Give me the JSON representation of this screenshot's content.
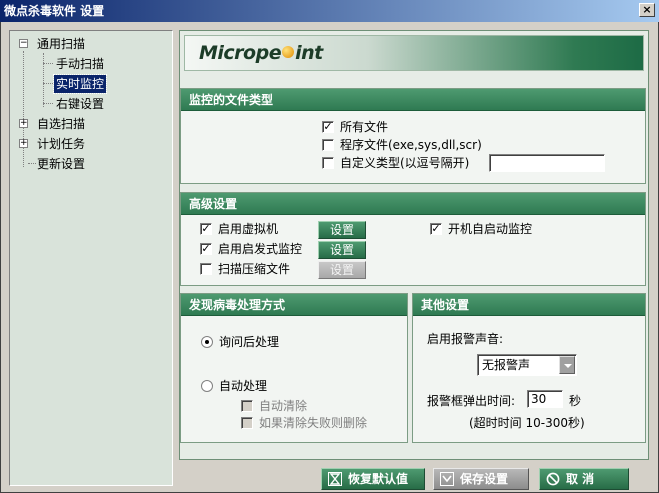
{
  "window": {
    "title": "微点杀毒软件 设置",
    "close_label": "×"
  },
  "tree": {
    "items": [
      {
        "label": "通用扫描",
        "expander": "−"
      },
      {
        "label": "手动扫描"
      },
      {
        "label": "实时监控"
      },
      {
        "label": "右键设置"
      },
      {
        "label": "自选扫描",
        "expander": "+"
      },
      {
        "label": "计划任务",
        "expander": "+"
      },
      {
        "label": "更新设置"
      }
    ]
  },
  "banner": {
    "logo_pre": "Micrope",
    "logo_post": "int"
  },
  "file_types": {
    "header": "监控的文件类型",
    "all_files": "所有文件",
    "program_files": "程序文件(exe,sys,dll,scr)",
    "custom_types": "自定义类型(以逗号隔开)",
    "custom_value": ""
  },
  "advanced": {
    "header": "高级设置",
    "vm": "启用虚拟机",
    "heuristic": "启用启发式监控",
    "compressed": "扫描压缩文件",
    "set_label": "设置",
    "autostart": "开机自启动监控"
  },
  "virus_handling": {
    "header": "发现病毒处理方式",
    "ask": "询问后处理",
    "auto": "自动处理",
    "auto_clean": "自动清除",
    "delete_if_fail": "如果清除失败则删除"
  },
  "other": {
    "header": "其他设置",
    "sound_label": "启用报警声音:",
    "sound_value": "无报警声",
    "popup_label": "报警框弹出时间:",
    "popup_value": "30",
    "popup_unit": "秒",
    "timeout_note": "(超时时间 10-300秒)"
  },
  "footer": {
    "restore": "恢复默认值",
    "save": "保存设置",
    "cancel": "取 消"
  }
}
